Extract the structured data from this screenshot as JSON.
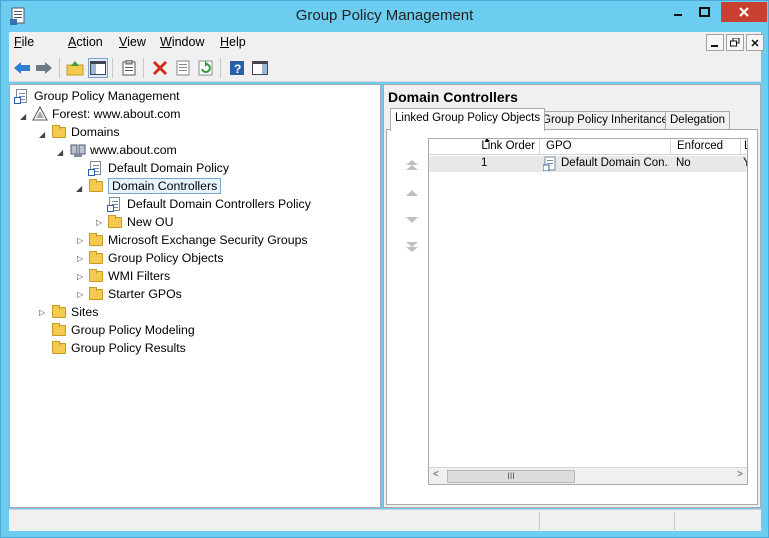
{
  "window": {
    "title": "Group Policy Management"
  },
  "menu": [
    {
      "label": "File",
      "u": "F",
      "rest": "ile"
    },
    {
      "label": "Action",
      "u": "A",
      "rest": "ction"
    },
    {
      "label": "View",
      "u": "V",
      "rest": "iew"
    },
    {
      "label": "Window",
      "u": "W",
      "rest": "indow"
    },
    {
      "label": "Help",
      "u": "H",
      "rest": "elp"
    }
  ],
  "toolbar": [
    "back-arrow-icon",
    "forward-arrow-icon",
    "up-folder-icon",
    "show-hide-tree-icon",
    "properties-icon",
    "delete-icon",
    "export-list-icon",
    "refresh-icon",
    "help-icon",
    "show-action-pane-icon"
  ],
  "tree": {
    "root": "Group Policy Management",
    "forest": "Forest: www.about.com",
    "domains": "Domains",
    "domain": "www.about.com",
    "default_domain_policy": "Default Domain Policy",
    "domain_controllers": "Domain Controllers",
    "default_dc_policy": "Default Domain Controllers Policy",
    "new_ou": "New OU",
    "exchange_groups": "Microsoft Exchange Security Groups",
    "gpo": "Group Policy Objects",
    "wmi": "WMI Filters",
    "starter": "Starter GPOs",
    "sites": "Sites",
    "modeling": "Group Policy Modeling",
    "results": "Group Policy Results"
  },
  "right": {
    "title": "Domain Controllers",
    "tabs": [
      "Linked Group Policy Objects",
      "Group Policy Inheritance",
      "Delegation"
    ],
    "columns": [
      "Link Order",
      "GPO",
      "Enforced",
      "L"
    ],
    "rows": [
      {
        "link_order": "1",
        "gpo": "Default Domain Con...",
        "enforced": "No",
        "more": "Y"
      }
    ],
    "scroll_thumb": "III"
  },
  "colors": {
    "titlebar": "#6dcdf0",
    "close": "#c74030",
    "selection": "#e5f3fb"
  }
}
